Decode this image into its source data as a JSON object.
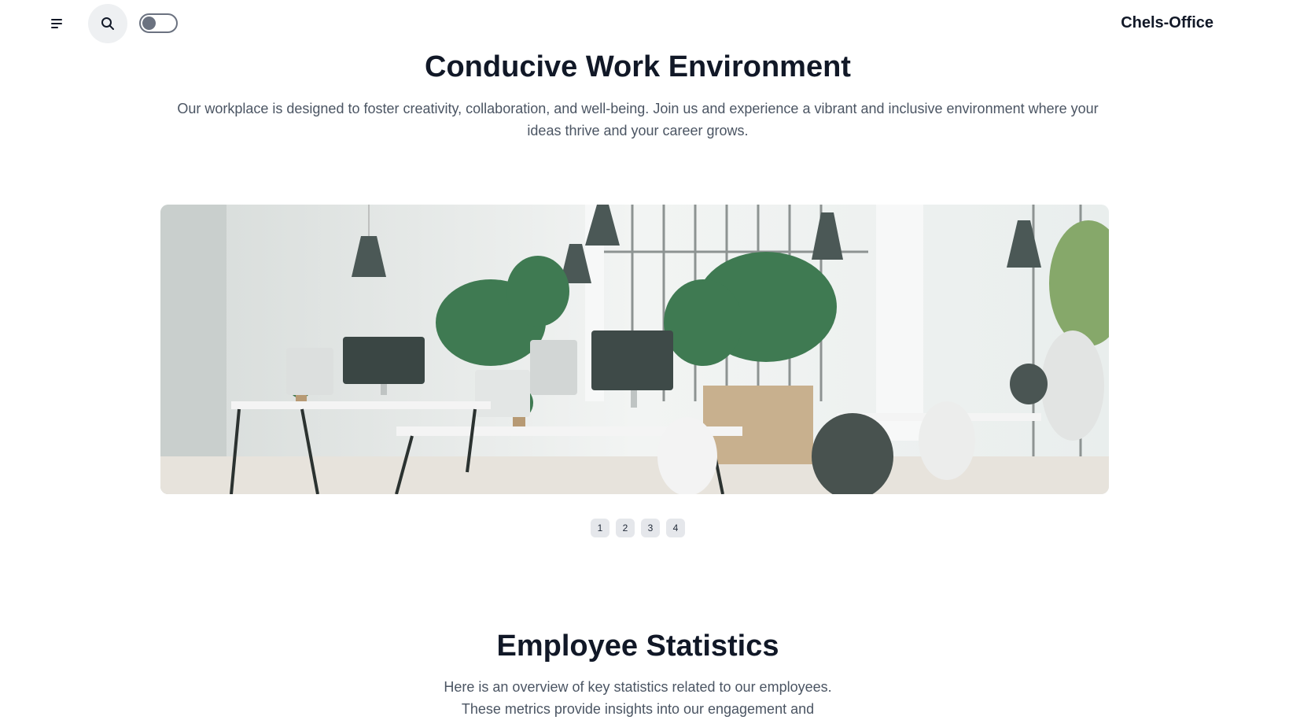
{
  "navbar": {
    "brand": "Chels-Office",
    "menu_icon": "menu-icon",
    "search_icon": "search-icon",
    "theme_toggle_state": "off"
  },
  "environment": {
    "title": "Conducive Work Environment",
    "description": "Our workplace is designed to foster creativity, collaboration, and well-being. Join us and experience a vibrant and inclusive environment where your ideas thrive and your career grows.",
    "carousel": {
      "slides": [
        "1",
        "2",
        "3",
        "4"
      ],
      "active_slide": "1"
    }
  },
  "statistics": {
    "title": "Employee Statistics",
    "description": "Here is an overview of key statistics related to our employees. These metrics provide insights into our engagement and"
  },
  "colors": {
    "heading": "#111827",
    "body_text": "#4b5563",
    "indicator_bg": "#e5e7eb",
    "search_bg": "#eef0f2"
  }
}
